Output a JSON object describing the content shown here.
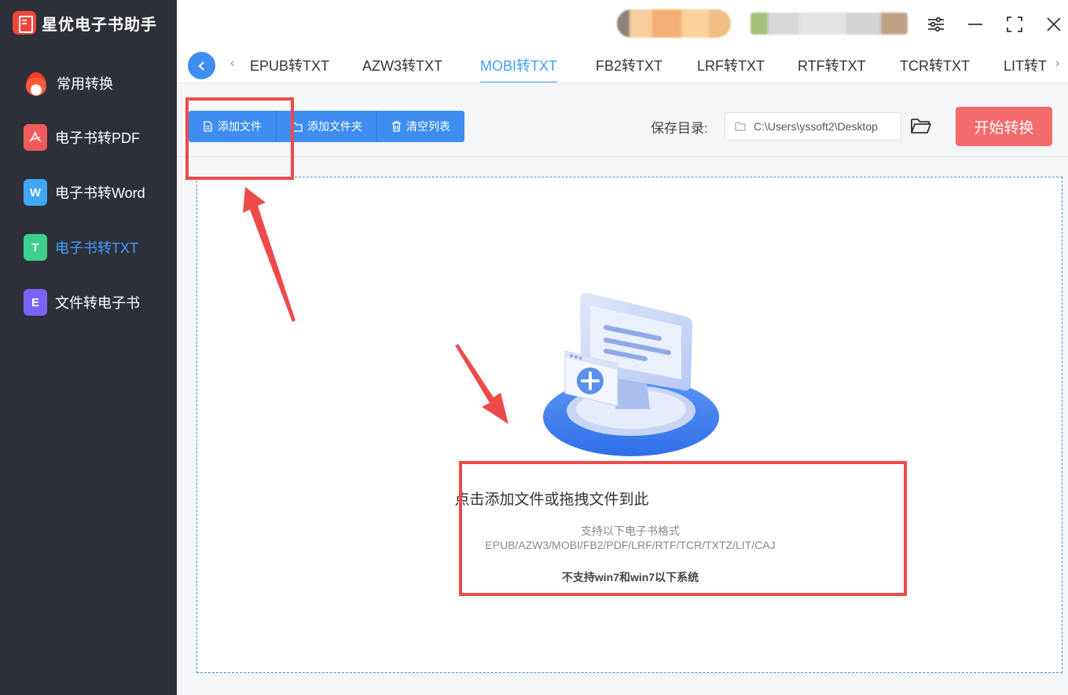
{
  "app": {
    "name": "星优电子书助手"
  },
  "sidebar": {
    "items": [
      {
        "label": "常用转换",
        "icon": "fire-icon",
        "color": "#ff4b2b"
      },
      {
        "label": "电子书转PDF",
        "icon": "pdf-icon",
        "color": "#f25b5b"
      },
      {
        "label": "电子书转Word",
        "icon": "word-icon",
        "color": "#3fa7f5",
        "glyph": "W"
      },
      {
        "label": "电子书转TXT",
        "icon": "txt-icon",
        "color": "#3ccf8e",
        "glyph": "T",
        "active": true
      },
      {
        "label": "文件转电子书",
        "icon": "ebook-icon",
        "color": "#7b63f3",
        "glyph": "E"
      }
    ]
  },
  "tabs": [
    {
      "label": "EPUB转TXT"
    },
    {
      "label": "AZW3转TXT"
    },
    {
      "label": "MOBI转TXT",
      "active": true
    },
    {
      "label": "FB2转TXT"
    },
    {
      "label": "LRF转TXT"
    },
    {
      "label": "RTF转TXT"
    },
    {
      "label": "TCR转TXT"
    },
    {
      "label": "LIT转T"
    }
  ],
  "toolbar": {
    "add_file": "添加文件",
    "add_folder": "添加文件夹",
    "clear_list": "清空列表",
    "save_dir_label": "保存目录:",
    "save_path": "C:\\Users\\yssoft2\\Desktop",
    "start": "开始转换"
  },
  "dropzone": {
    "title": "点击添加文件或拖拽文件到此",
    "subtitle": "支持以下电子书格式",
    "formats": "EPUB/AZW3/MOBI/FB2/PDF/LRF/RTF/TCR/TXTZ/LIT/CAJ",
    "warning": "不支持win7和win7以下系统"
  },
  "colors": {
    "accent": "#409eff",
    "button": "#3d8ef0",
    "start": "#f46b6b",
    "annotation": "#ef4a4a",
    "sidebar": "#2d3039"
  }
}
